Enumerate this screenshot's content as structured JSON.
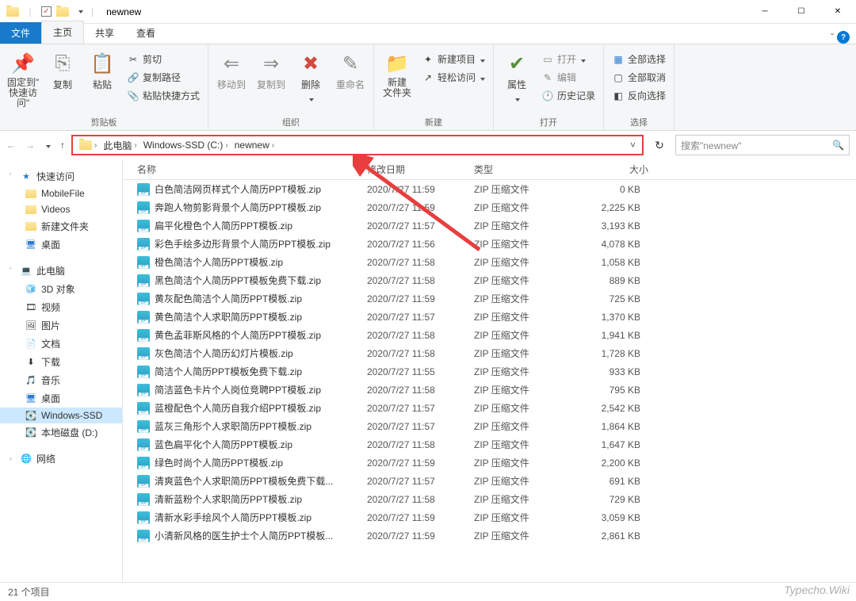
{
  "window": {
    "title": "newnew"
  },
  "qat": {
    "checked": true
  },
  "tabs": {
    "file": "文件",
    "home": "主页",
    "share": "共享",
    "view": "查看"
  },
  "ribbon": {
    "clipboard": {
      "label": "剪贴板",
      "pin": "固定到\"\n快速访问\"",
      "copy": "复制",
      "paste": "粘贴",
      "cut": "剪切",
      "copypath": "复制路径",
      "pasteshortcut": "粘贴快捷方式"
    },
    "organize": {
      "label": "组织",
      "moveto": "移动到",
      "copyto": "复制到",
      "delete": "删除",
      "rename": "重命名"
    },
    "new": {
      "label": "新建",
      "newfolder": "新建\n文件夹",
      "newitem": "新建项目",
      "easyaccess": "轻松访问"
    },
    "open": {
      "label": "打开",
      "props": "属性",
      "open": "打开",
      "edit": "编辑",
      "history": "历史记录"
    },
    "select": {
      "label": "选择",
      "all": "全部选择",
      "none": "全部取消",
      "invert": "反向选择"
    }
  },
  "breadcrumb": {
    "items": [
      "此电脑",
      "Windows-SSD (C:)",
      "newnew"
    ]
  },
  "search": {
    "placeholder": "搜索\"newnew\""
  },
  "sidebar": {
    "quick": {
      "label": "快速访问",
      "items": [
        "MobileFile",
        "Videos",
        "新建文件夹",
        "桌面"
      ]
    },
    "thispc": {
      "label": "此电脑",
      "items": [
        "3D 对象",
        "视频",
        "图片",
        "文档",
        "下载",
        "音乐",
        "桌面",
        "Windows-SSD",
        "本地磁盘 (D:)"
      ]
    },
    "network": {
      "label": "网络"
    }
  },
  "columns": {
    "name": "名称",
    "date": "修改日期",
    "type": "类型",
    "size": "大小"
  },
  "filetype": "ZIP 压缩文件",
  "files": [
    {
      "name": "白色简洁网页样式个人简历PPT模板.zip",
      "date": "2020/7/27 11:59",
      "size": "0 KB"
    },
    {
      "name": "奔跑人物剪影背景个人简历PPT模板.zip",
      "date": "2020/7/27 11:59",
      "size": "2,225 KB"
    },
    {
      "name": "扁平化橙色个人简历PPT模板.zip",
      "date": "2020/7/27 11:57",
      "size": "3,193 KB"
    },
    {
      "name": "彩色手绘多边形背景个人简历PPT模板.zip",
      "date": "2020/7/27 11:56",
      "size": "4,078 KB"
    },
    {
      "name": "橙色简洁个人简历PPT模板.zip",
      "date": "2020/7/27 11:58",
      "size": "1,058 KB"
    },
    {
      "name": "黑色简洁个人简历PPT模板免费下载.zip",
      "date": "2020/7/27 11:58",
      "size": "889 KB"
    },
    {
      "name": "黄灰配色简洁个人简历PPT模板.zip",
      "date": "2020/7/27 11:59",
      "size": "725 KB"
    },
    {
      "name": "黄色简洁个人求职简历PPT模板.zip",
      "date": "2020/7/27 11:57",
      "size": "1,370 KB"
    },
    {
      "name": "黄色孟菲斯风格的个人简历PPT模板.zip",
      "date": "2020/7/27 11:58",
      "size": "1,941 KB"
    },
    {
      "name": "灰色简洁个人简历幻灯片模板.zip",
      "date": "2020/7/27 11:58",
      "size": "1,728 KB"
    },
    {
      "name": "简洁个人简历PPT模板免费下载.zip",
      "date": "2020/7/27 11:55",
      "size": "933 KB"
    },
    {
      "name": "简洁蓝色卡片个人岗位竞聘PPT模板.zip",
      "date": "2020/7/27 11:58",
      "size": "795 KB"
    },
    {
      "name": "蓝橙配色个人简历自我介绍PPT模板.zip",
      "date": "2020/7/27 11:57",
      "size": "2,542 KB"
    },
    {
      "name": "蓝灰三角形个人求职简历PPT模板.zip",
      "date": "2020/7/27 11:57",
      "size": "1,864 KB"
    },
    {
      "name": "蓝色扁平化个人简历PPT模板.zip",
      "date": "2020/7/27 11:58",
      "size": "1,647 KB"
    },
    {
      "name": "绿色时尚个人简历PPT模板.zip",
      "date": "2020/7/27 11:59",
      "size": "2,200 KB"
    },
    {
      "name": "清爽蓝色个人求职简历PPT模板免费下载...",
      "date": "2020/7/27 11:57",
      "size": "691 KB"
    },
    {
      "name": "清新蓝粉个人求职简历PPT模板.zip",
      "date": "2020/7/27 11:58",
      "size": "729 KB"
    },
    {
      "name": "清新水彩手绘风个人简历PPT模板.zip",
      "date": "2020/7/27 11:59",
      "size": "3,059 KB"
    },
    {
      "name": "小清新风格的医生护士个人简历PPT模板...",
      "date": "2020/7/27 11:59",
      "size": "2,861 KB"
    }
  ],
  "status": {
    "count": "21 个项目"
  },
  "watermark": "Typecho.Wiki"
}
